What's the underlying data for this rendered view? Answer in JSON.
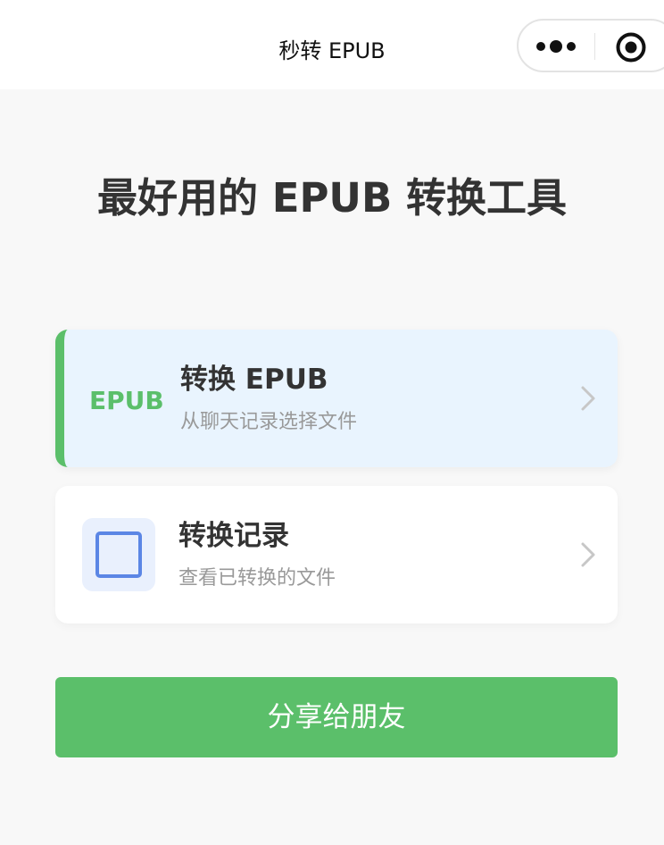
{
  "nav": {
    "title": "秒转 EPUB",
    "capsule": {
      "more_icon": "more-dots-icon",
      "close_icon": "record-circle-icon"
    }
  },
  "main": {
    "headline": "最好用的 EPUB 转换工具",
    "cards": [
      {
        "badge": "EPUB",
        "title": "转换 EPUB",
        "subtitle": "从聊天记录选择文件",
        "icon": "chevron-right-icon"
      },
      {
        "icon_left": "square-outline-icon",
        "title": "转换记录",
        "subtitle": "查看已转换的文件",
        "icon": "chevron-right-icon"
      }
    ],
    "share_button": "分享给朋友"
  },
  "colors": {
    "accent_green": "#5bbf6a",
    "active_card_bg": "#e9f4fe",
    "icon_blue": "#5b86e5",
    "page_bg": "#f8f8f8"
  }
}
